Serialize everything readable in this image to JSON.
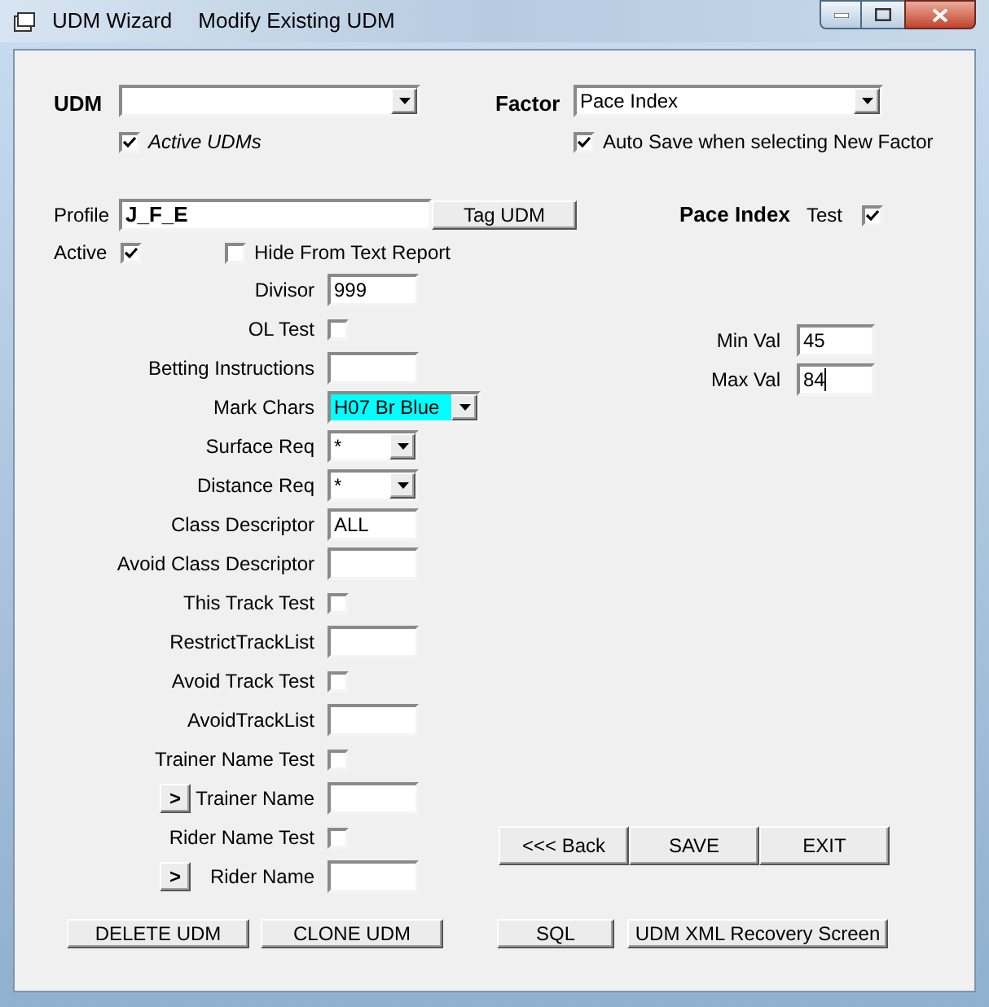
{
  "window": {
    "title": "UDM Wizard",
    "subtitle": "Modify Existing UDM"
  },
  "udm": {
    "label": "UDM"
  },
  "active_udms": {
    "label": "Active UDMs",
    "checked": true
  },
  "factor": {
    "label": "Factor",
    "value": "Pace Index"
  },
  "auto_save": {
    "label": "Auto Save when selecting New Factor",
    "checked": true
  },
  "profile": {
    "label": "Profile",
    "value": "J_F_E",
    "button": "Tag UDM"
  },
  "factor_heading": "Pace Index",
  "test": {
    "label": "Test",
    "checked": true
  },
  "active": {
    "label": "Active",
    "checked": true
  },
  "hide_from_report": {
    "label": "Hide From Text Report",
    "checked": false
  },
  "fields": [
    {
      "kind": "text",
      "label": "Divisor",
      "value": "999"
    },
    {
      "kind": "checkbox",
      "label": "OL Test",
      "checked": false
    },
    {
      "kind": "text",
      "label": "Betting Instructions"
    },
    {
      "kind": "color-select",
      "label": "Mark Chars",
      "value": "H07 Br Blue",
      "color": "#00ffff"
    },
    {
      "kind": "select",
      "label": "Surface Req",
      "value": "*"
    },
    {
      "kind": "select",
      "label": "Distance Req",
      "value": "*"
    },
    {
      "kind": "text",
      "label": "Class Descriptor",
      "value": "ALL"
    },
    {
      "kind": "text",
      "label": "Avoid Class Descriptor"
    },
    {
      "kind": "checkbox",
      "label": "This Track Test",
      "checked": false
    },
    {
      "kind": "text",
      "label": "RestrictTrackList"
    },
    {
      "kind": "checkbox",
      "label": "Avoid Track Test",
      "checked": false
    },
    {
      "kind": "text",
      "label": "AvoidTrackList"
    },
    {
      "kind": "checkbox",
      "label": "Trainer Name Test",
      "checked": false
    },
    {
      "kind": "text",
      "label": "Trainer Name",
      "button": ">"
    },
    {
      "kind": "checkbox",
      "label": "Rider Name Test",
      "checked": false
    },
    {
      "kind": "text",
      "label": "Rider Name",
      "button": ">"
    }
  ],
  "range": [
    {
      "label": "Min Val",
      "value": "45",
      "focused": false
    },
    {
      "label": "Max Val",
      "value": "84",
      "focused": true
    }
  ],
  "nav_buttons": [
    "<<< Back",
    "SAVE",
    "EXIT"
  ],
  "bottom_left_buttons": [
    "DELETE UDM",
    "CLONE UDM"
  ],
  "bottom_right_buttons": [
    "SQL",
    "UDM XML Recovery Screen"
  ]
}
